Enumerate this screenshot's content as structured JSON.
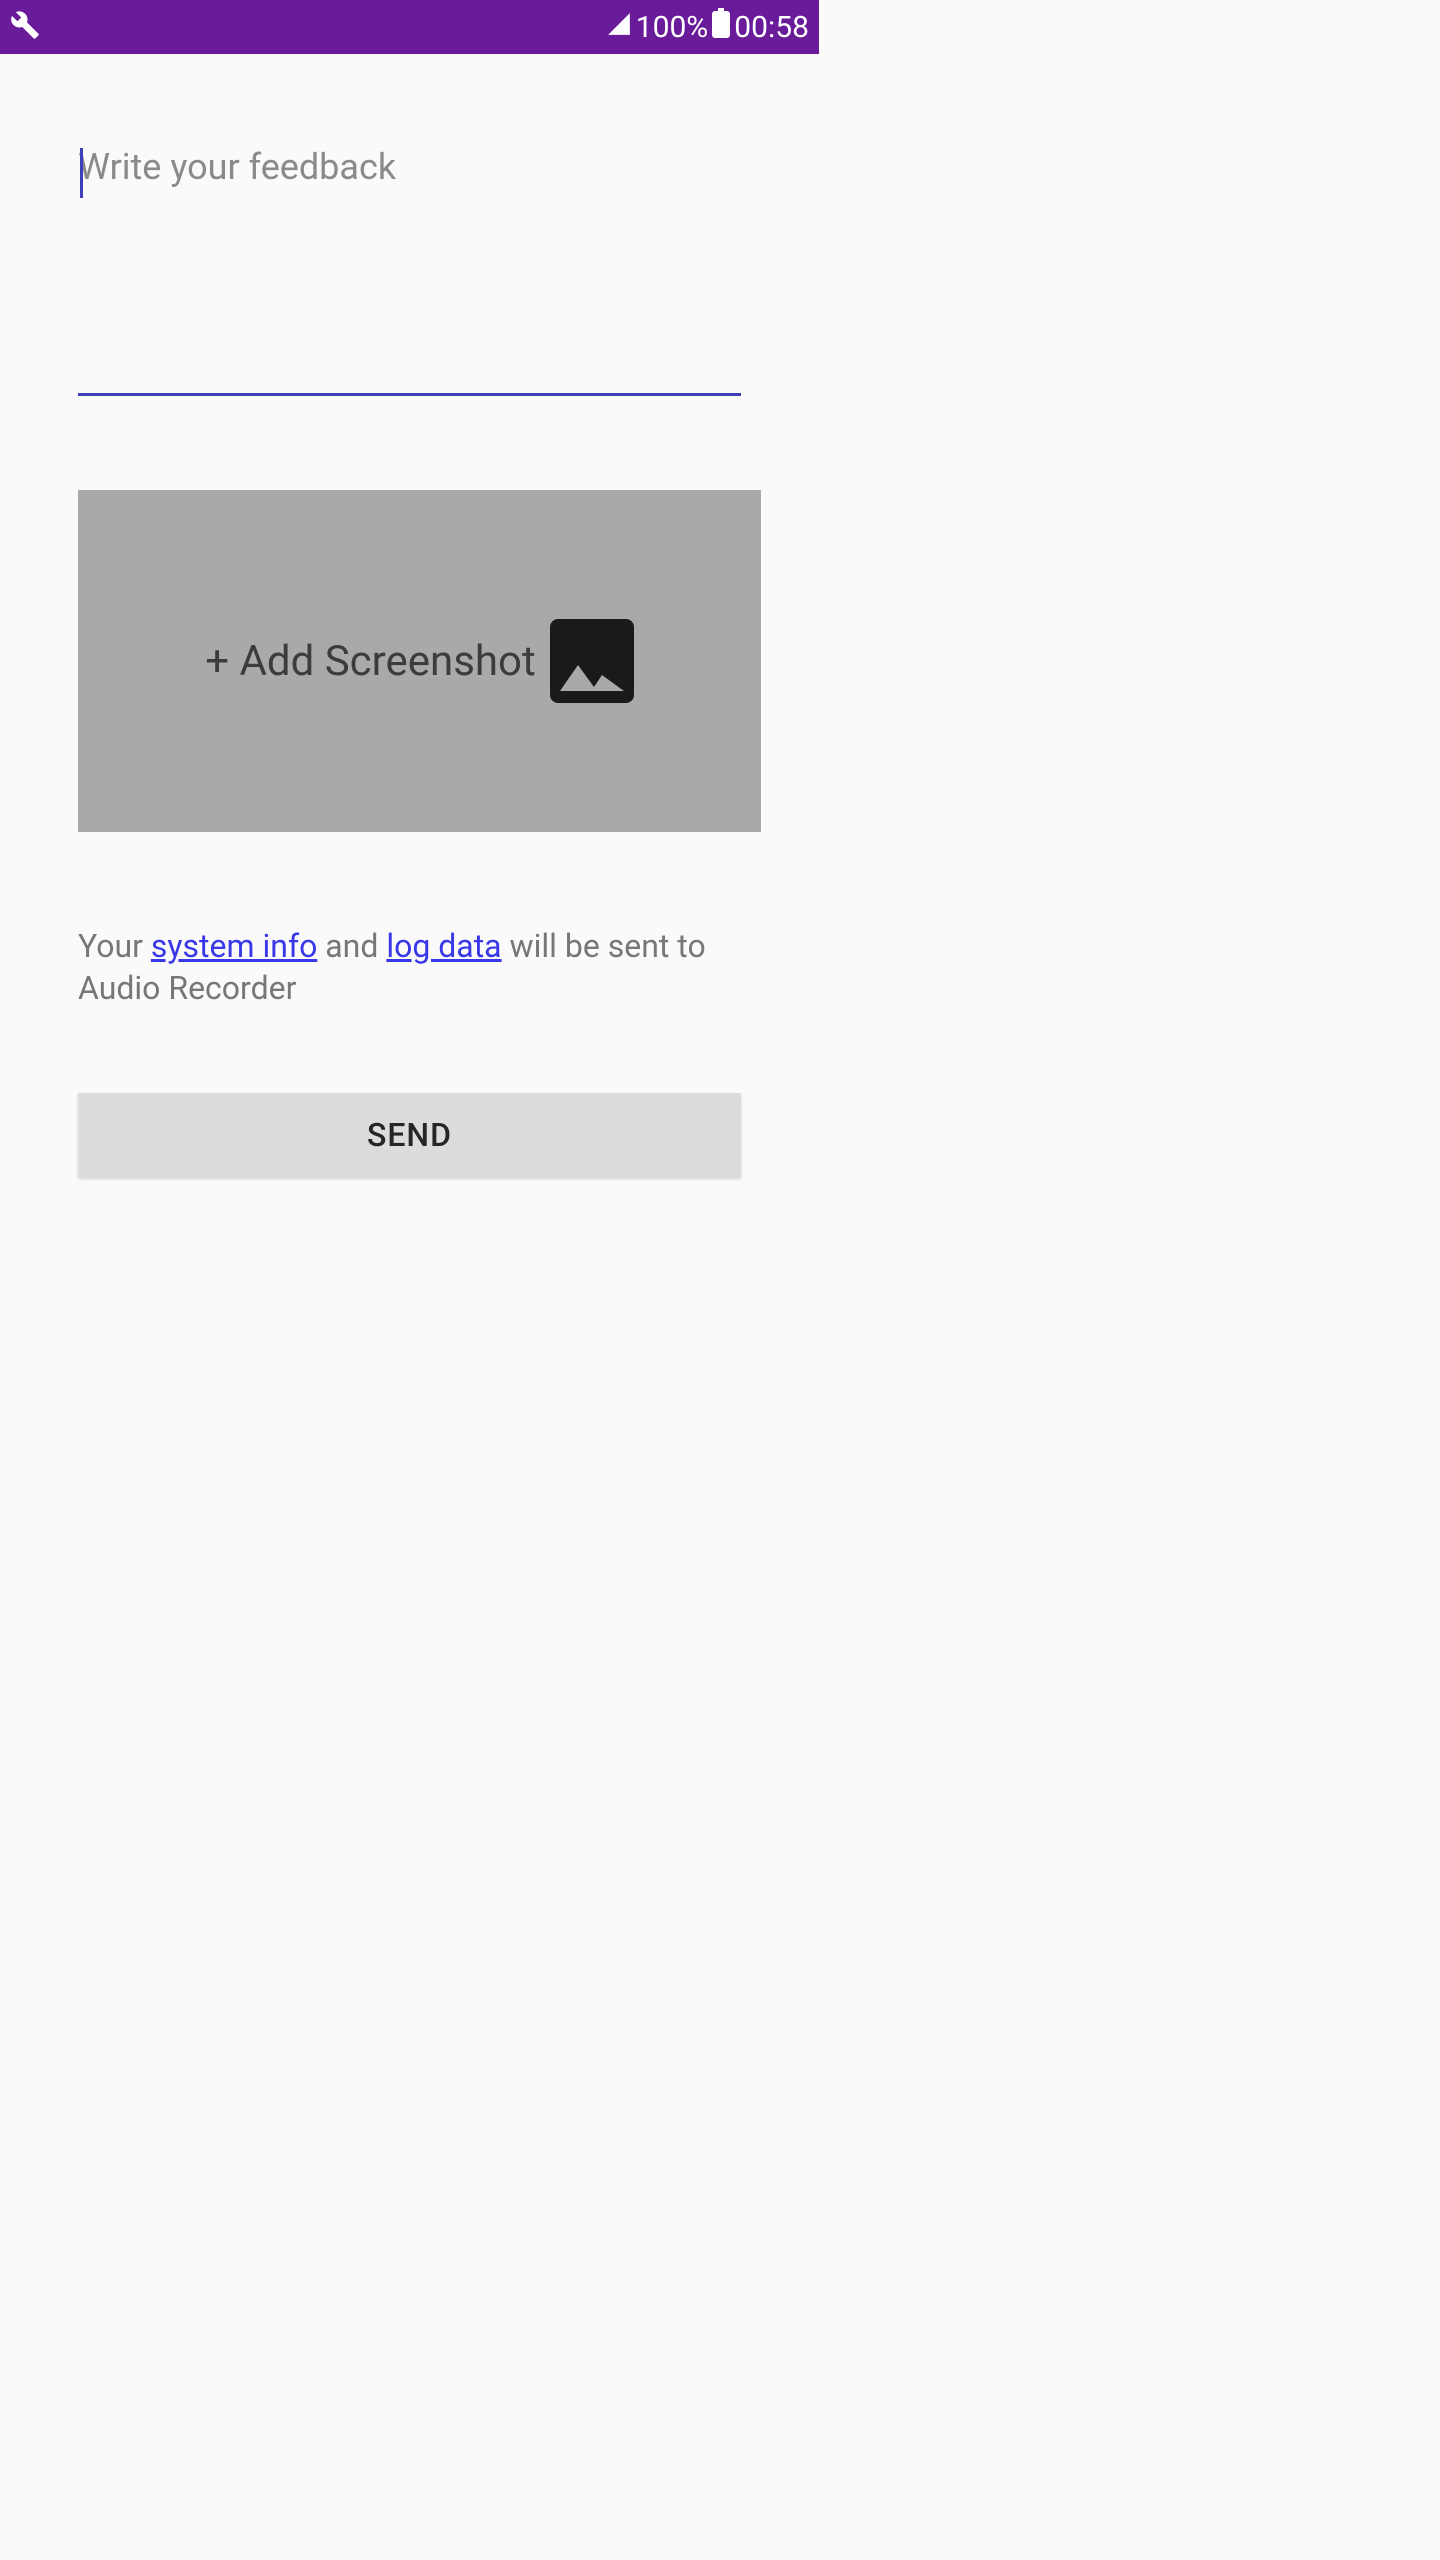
{
  "status_bar": {
    "battery_percent": "100%",
    "time": "00:58"
  },
  "feedback": {
    "placeholder": "Write your feedback",
    "value": ""
  },
  "screenshot_button": {
    "label": "+ Add Screenshot"
  },
  "info_text": {
    "prefix": "Your ",
    "system_info_link": "system info",
    "middle": " and ",
    "log_data_link": "log data",
    "suffix": " will be sent to Audio Recorder"
  },
  "send_button": {
    "label": "SEND"
  }
}
